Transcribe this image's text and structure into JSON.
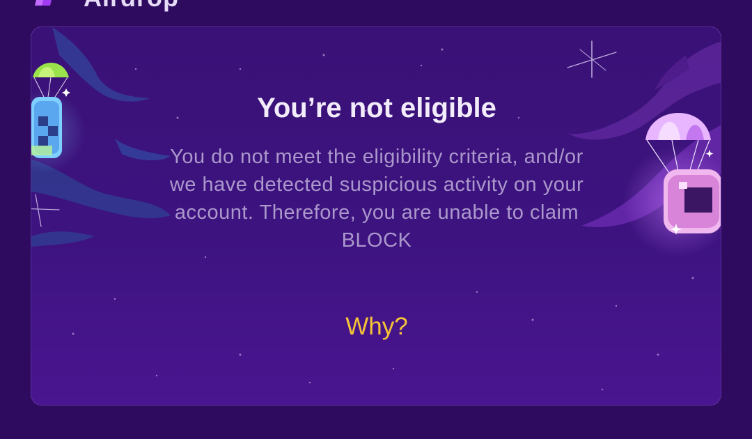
{
  "header": {
    "title": "Airdrop",
    "logo_icon": "gem-logo-icon"
  },
  "card": {
    "title": "You’re not eligible",
    "message": "You do not meet the eligibility criteria, and/or we have detected suspicious activity on your account. Therefore, you are unable to claim BLOCK",
    "link_label": "Why?",
    "decorations": [
      "parachute-coin-icon",
      "parachute-chip-icon",
      "sparkle-icon",
      "space-cloud"
    ]
  },
  "colors": {
    "background": "#2e0b5e",
    "card": "#3d1380",
    "title": "#f2ecfb",
    "message": "#ab98cc",
    "link": "#f5c337"
  }
}
